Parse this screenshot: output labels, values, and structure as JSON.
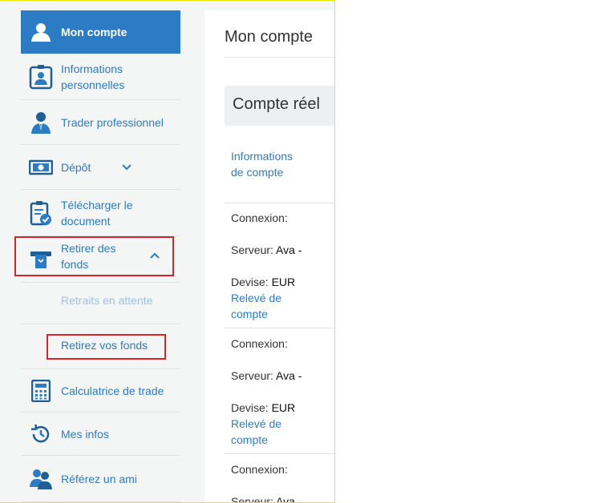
{
  "sidebar": {
    "items": [
      {
        "label": "Mon compte",
        "icon": "user-icon"
      },
      {
        "label_1": "Informations",
        "label_2": "personnelles",
        "icon": "id-card-icon"
      },
      {
        "label": "Trader professionnel",
        "icon": "businessman-icon"
      },
      {
        "label": "Dépôt",
        "icon": "banknote-icon"
      },
      {
        "label_1": "Télécharger le",
        "label_2": "document",
        "icon": "clipboard-check-icon"
      },
      {
        "label_1": "Retirer des",
        "label_2": "fonds",
        "icon": "atm-withdraw-icon"
      },
      {
        "label": "Retraits en attente"
      },
      {
        "label": "Retirez vos fonds"
      },
      {
        "label": "Calculatrice de trade",
        "icon": "calculator-icon"
      },
      {
        "label": "Mes infos",
        "icon": "history-icon"
      },
      {
        "label": "Référez un ami",
        "icon": "users-icon"
      }
    ]
  },
  "main": {
    "title": "Mon compte",
    "section_title": "Compte réel",
    "account_info_1": "Informations",
    "account_info_2": "de compte",
    "accounts": [
      {
        "connexion": "Connexion:",
        "serveur_label": "Serveur:",
        "serveur_value": "Ava -",
        "devise_label": "Devise:",
        "devise_value": "EUR",
        "releve_1": "Relevé de",
        "releve_2": "compte"
      },
      {
        "connexion": "Connexion:",
        "serveur_label": "Serveur:",
        "serveur_value": "Ava -",
        "devise_label": "Devise:",
        "devise_value": "EUR",
        "releve_1": "Relevé de",
        "releve_2": "compte"
      },
      {
        "connexion": "Connexion:",
        "serveur_label": "Serveur:",
        "serveur_value": "Ava -"
      }
    ]
  },
  "colors": {
    "accent": "#2b7cc4",
    "highlight": "#d9232b",
    "disabled": "#9ec3e0"
  }
}
